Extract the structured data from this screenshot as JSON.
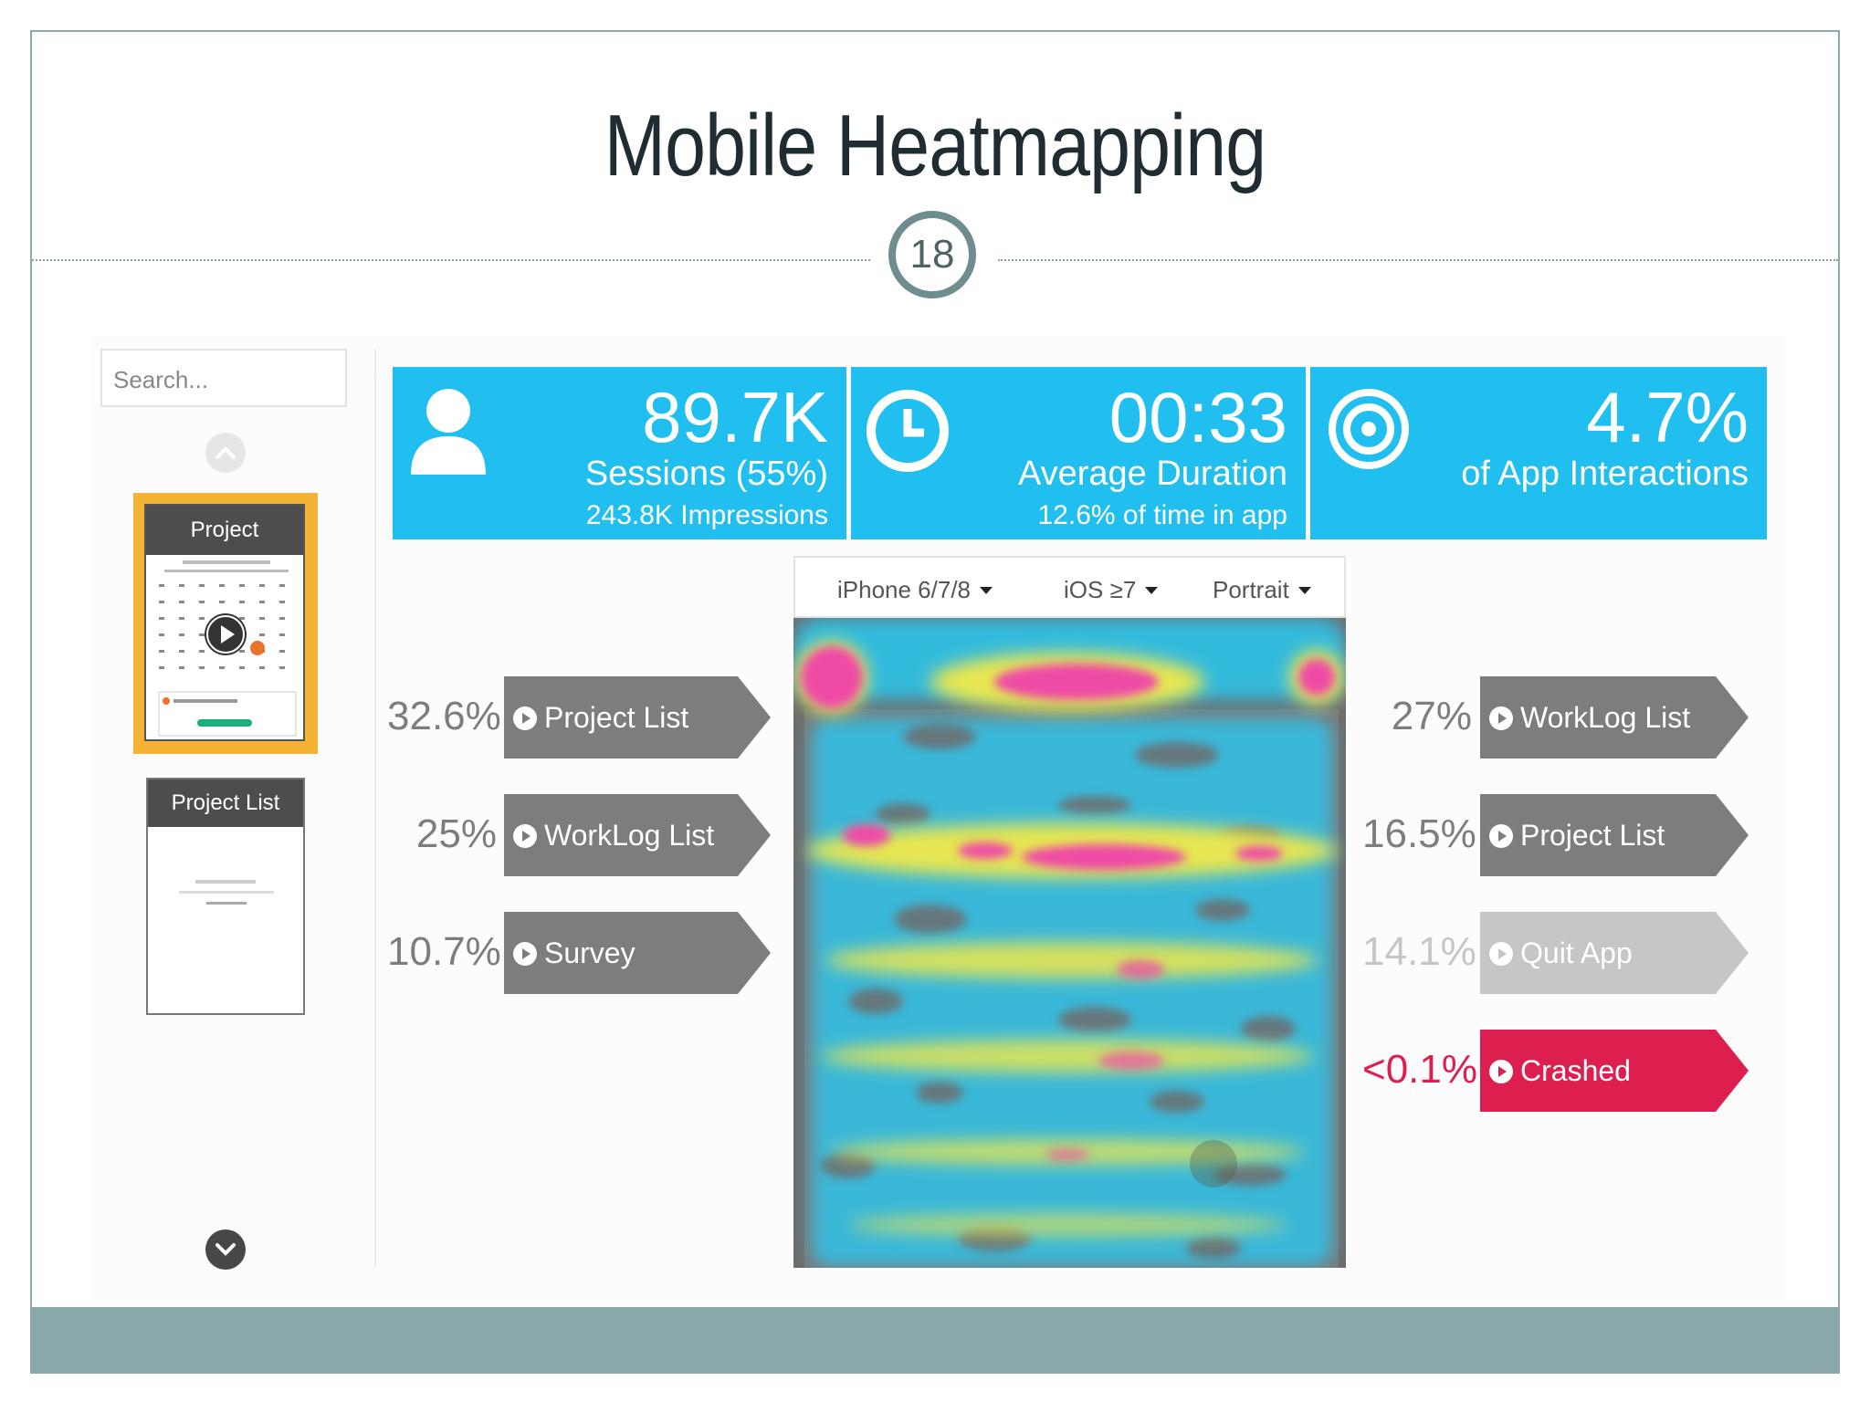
{
  "slide": {
    "title": "Mobile Heatmapping",
    "number": "18"
  },
  "sidebar": {
    "search_placeholder": "Search...",
    "screens": [
      {
        "label": "Project",
        "selected": true
      },
      {
        "label": "Project List",
        "selected": false
      }
    ]
  },
  "stats": [
    {
      "icon": "user-icon",
      "value": "89.7K",
      "label": "Sessions (55%)",
      "sub": "243.8K Impressions"
    },
    {
      "icon": "clock-icon",
      "value": "00:33",
      "label": "Average Duration",
      "sub": "12.6% of time in app"
    },
    {
      "icon": "target-icon",
      "value": "4.7%",
      "label": "of App Interactions",
      "sub": ""
    }
  ],
  "device_filters": [
    {
      "label": "iPhone 6/7/8"
    },
    {
      "label": "iOS ≥7"
    },
    {
      "label": "Portrait"
    }
  ],
  "incoming_flows": [
    {
      "pct": "32.6%",
      "label": "Project List"
    },
    {
      "pct": "25%",
      "label": "WorkLog List"
    },
    {
      "pct": "10.7%",
      "label": "Survey"
    }
  ],
  "outgoing_flows": [
    {
      "pct": "27%",
      "label": "WorkLog List",
      "kind": "screen"
    },
    {
      "pct": "16.5%",
      "label": "Project List",
      "kind": "screen"
    },
    {
      "pct": "14.1%",
      "label": "Quit App",
      "kind": "quit"
    },
    {
      "pct": "<0.1%",
      "label": "Crashed",
      "kind": "crash"
    }
  ],
  "colors": {
    "stat_bg": "#21bff0",
    "flow_gray": "#7d7d7f",
    "quit_gray": "#c6c6c8",
    "crash_red": "#dc1f4e",
    "selected_thumb": "#f5b335",
    "footer": "#8ba9ab"
  }
}
